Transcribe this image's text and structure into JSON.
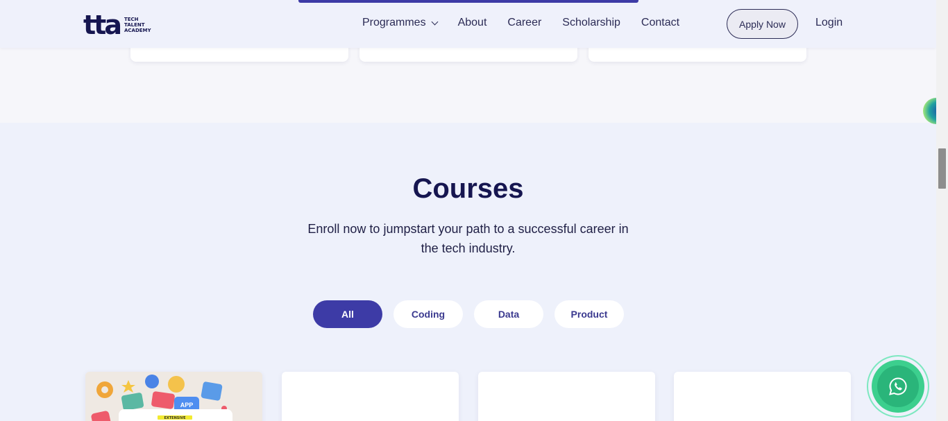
{
  "header": {
    "logo_mark": "tta",
    "logo_lines": [
      "TECH",
      "TALENT",
      "ACADEMY"
    ],
    "nav": [
      {
        "label": "Programmes",
        "has_dropdown": true
      },
      {
        "label": "About"
      },
      {
        "label": "Career"
      },
      {
        "label": "Scholarship"
      },
      {
        "label": "Contact"
      }
    ],
    "apply_label": "Apply Now",
    "login_label": "Login"
  },
  "courses": {
    "title": "Courses",
    "subtitle": "Enroll now to jumpstart your path to a successful career in the tech industry.",
    "filters": [
      {
        "label": "All",
        "active": true
      },
      {
        "label": "Coding",
        "active": false
      },
      {
        "label": "Data",
        "active": false
      },
      {
        "label": "Product",
        "active": false
      }
    ],
    "first_card_badge": "EXTENSIVE",
    "first_card_art_label": "APP"
  },
  "colors": {
    "brand": "#3d3ba6",
    "brand_dark": "#161650",
    "whatsapp": "#2ab57a"
  },
  "icons": {
    "whatsapp": "whatsapp-icon",
    "dropdown": "chevron-down-icon"
  }
}
